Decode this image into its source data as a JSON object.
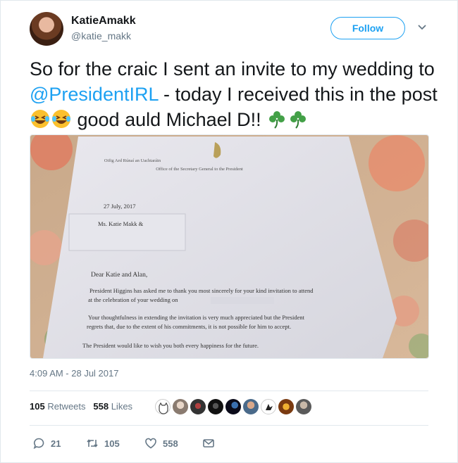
{
  "user": {
    "name": "KatieAmakk",
    "handle": "@katie_makk"
  },
  "follow_label": "Follow",
  "tweet": {
    "part1": "So for the craic I sent an invite to my wedding to ",
    "mention": "@PresidentIRL",
    "part2": "  - today I received this in the post ",
    "part3": " good auld Michael D!! "
  },
  "letter": {
    "header_irish": "Oifig Ard Rúnaí an Uachtaráin",
    "header_english": "Office of the Secretary General to the President",
    "date": "27 July, 2017",
    "address": "Ms. Katie Makk &",
    "salutation": "Dear Katie and Alan,",
    "para1_line1": "President Higgins has asked me to thank you most sincerely for your kind invitation to attend",
    "para1_line2": "at the celebration of your wedding on",
    "para2_line1": "Your thoughtfulness in extending the invitation is very much appreciated but the President",
    "para2_line2": "regrets that, due to the extent of his commitments, it is not possible for him to accept.",
    "para3": "The President would like to wish you both every happiness for the future."
  },
  "timestamp": "4:09 AM - 28 Jul 2017",
  "stats": {
    "retweets_count": "105",
    "retweets_label": "Retweets",
    "likes_count": "558",
    "likes_label": "Likes"
  },
  "actions": {
    "replies": "21",
    "retweets": "105",
    "likes": "558"
  },
  "colors": {
    "accent": "#1da1f2",
    "muted": "#657786",
    "text": "#14171a"
  }
}
